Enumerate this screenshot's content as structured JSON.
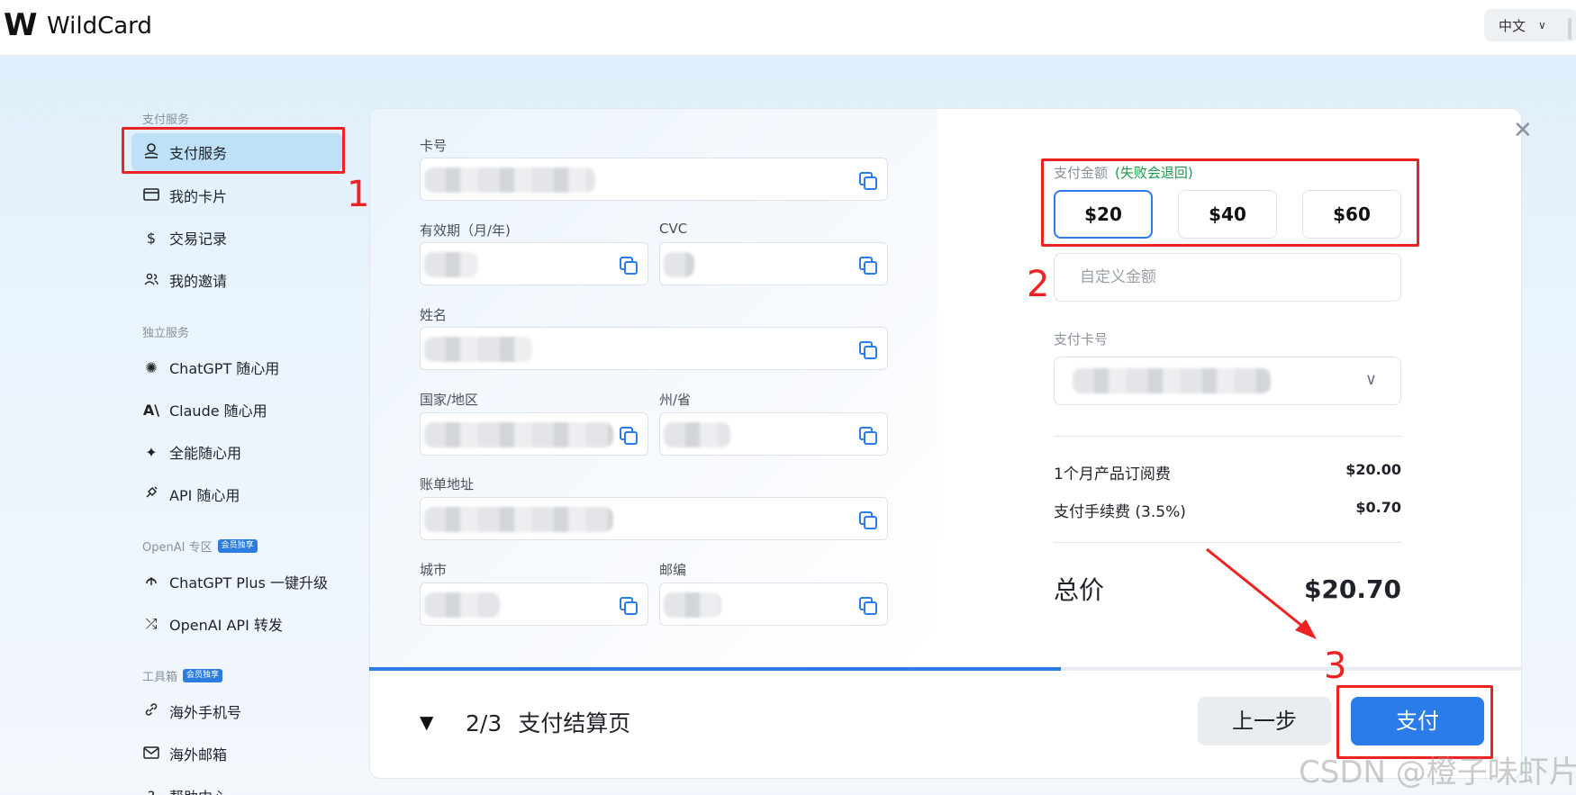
{
  "header": {
    "logo_text": "W",
    "app_title": "WildCard",
    "language": "中文"
  },
  "sidebar": {
    "sections": [
      {
        "title": "支付服务"
      },
      {
        "title": "独立服务"
      },
      {
        "title": "OpenAI 专区",
        "badge": "会员独享"
      },
      {
        "title": "工具箱",
        "badge": "会员独享"
      }
    ],
    "items": [
      {
        "label": "支付服务",
        "icon": "payment-service-icon",
        "active": true
      },
      {
        "label": "我的卡片",
        "icon": "card-icon"
      },
      {
        "label": "交易记录",
        "icon": "dollar-icon"
      },
      {
        "label": "我的邀请",
        "icon": "users-icon"
      },
      {
        "label": "ChatGPT 随心用",
        "icon": "openai-icon"
      },
      {
        "label": "Claude 随心用",
        "icon": "anthropic-icon"
      },
      {
        "label": "全能随心用",
        "icon": "sparkle-icon"
      },
      {
        "label": "API 随心用",
        "icon": "api-plug-icon"
      },
      {
        "label": "ChatGPT Plus 一键升级",
        "icon": "upgrade-icon"
      },
      {
        "label": "OpenAI API 转发",
        "icon": "shuffle-icon"
      },
      {
        "label": "海外手机号",
        "icon": "phone-link-icon"
      },
      {
        "label": "海外邮箱",
        "icon": "mail-icon"
      },
      {
        "label": "帮助中心",
        "icon": "help-icon"
      }
    ]
  },
  "card_details": {
    "card_number_label": "卡号",
    "expiry_label": "有效期（月/年)",
    "cvc_label": "CVC",
    "name_label": "姓名",
    "country_label": "国家/地区",
    "state_label": "州/省",
    "billing_address_label": "账单地址",
    "city_label": "城市",
    "zip_label": "邮编"
  },
  "payment": {
    "amount_label": "支付金额",
    "amount_note": "(失败会退回)",
    "amount_options": [
      "$20",
      "$40",
      "$60"
    ],
    "selected_amount": "$20",
    "custom_amount_placeholder": "自定义金额",
    "pay_card_label": "支付卡号",
    "subscription_label": "1个月产品订阅费",
    "subscription_value": "$20.00",
    "fee_label": "支付手续费 (3.5%)",
    "fee_value": "$0.70",
    "total_label": "总价",
    "total_value": "$20.70"
  },
  "progress": {
    "fraction": 0.6
  },
  "footer": {
    "step_toggle": "▼",
    "step_number": "2/3",
    "step_title": "支付结算页",
    "prev_button": "上一步",
    "pay_button": "支付"
  },
  "annotations": [
    "1",
    "2",
    "3"
  ],
  "watermark": "CSDN @橙子味虾片",
  "colors": {
    "accent": "#2b7ce9",
    "annotation_red": "#ee2222",
    "active_nav": "#bfe1f8",
    "note_green": "#1a9a4a"
  }
}
